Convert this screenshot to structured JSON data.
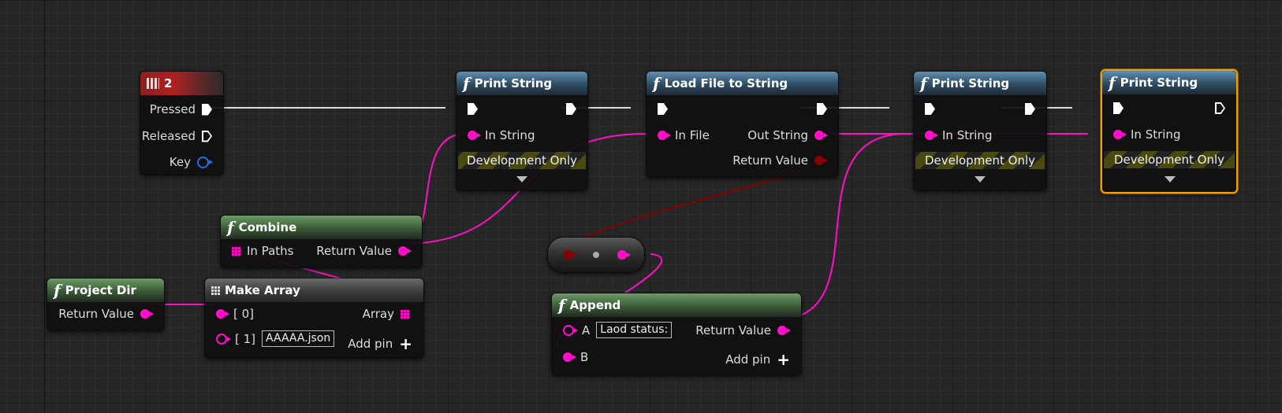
{
  "colors": {
    "exec": "#ffffff",
    "string": "#ff10c8",
    "bool": "#8a0000",
    "struct": "#1e6ef0",
    "selected": "#f0a000",
    "function_header": "#2e4c62",
    "pure_header": "#3b5a37"
  },
  "nodes": {
    "key_event": {
      "title": "2",
      "icon": "keyboard-icon",
      "pins": {
        "pressed": "Pressed",
        "released": "Released",
        "key": "Key"
      }
    },
    "print1": {
      "title": "Print String",
      "icon": "function-icon",
      "in_string": "In String",
      "dev_only": "Development Only"
    },
    "load_file": {
      "title": "Load File to String",
      "icon": "function-icon",
      "in_file": "In File",
      "out_string": "Out String",
      "return_value": "Return Value"
    },
    "print2": {
      "title": "Print String",
      "icon": "function-icon",
      "in_string": "In String",
      "dev_only": "Development Only"
    },
    "print3": {
      "title": "Print String",
      "icon": "function-icon",
      "in_string": "In String",
      "dev_only": "Development Only"
    },
    "combine": {
      "title": "Combine",
      "icon": "function-icon",
      "in_paths": "In Paths",
      "return_value": "Return Value"
    },
    "project_dir": {
      "title": "Project Dir",
      "icon": "function-icon",
      "return_value": "Return Value"
    },
    "make_array": {
      "title": "Make Array",
      "icon": "make-array-icon",
      "pin0": "[ 0]",
      "pin1": "[ 1]",
      "pin1_value": "AAAAA.json",
      "array": "Array",
      "add_pin": "Add pin"
    },
    "append": {
      "title": "Append",
      "icon": "function-icon",
      "a": "A",
      "a_value": "Laod status:",
      "b": "B",
      "return_value": "Return Value",
      "add_pin": "Add pin"
    }
  },
  "fn_glyph": "f"
}
